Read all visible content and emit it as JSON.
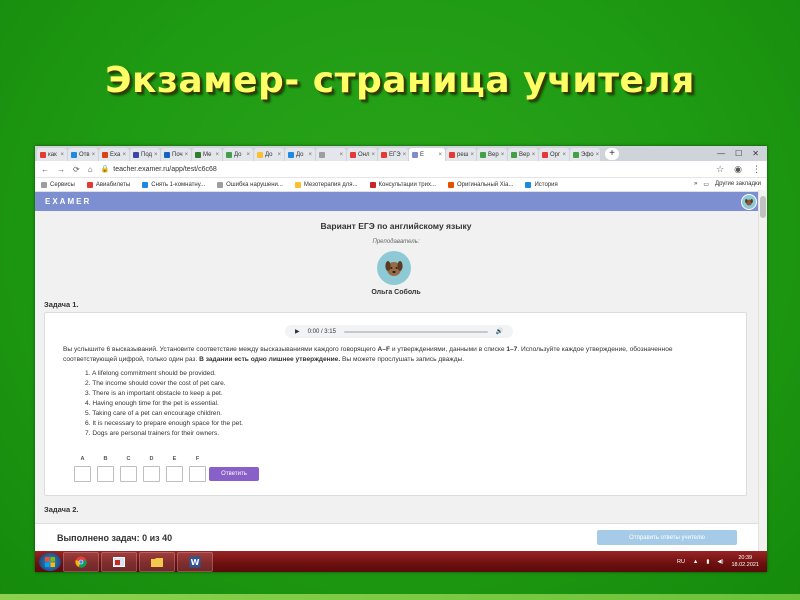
{
  "slide": {
    "title": "Экзамер- страница учителя"
  },
  "colors": {
    "background": "#1f9a13",
    "title": "#ffff66",
    "site_header": "#7d8fd0",
    "answer_button": "#8860c8",
    "send_button": "#a6cbe8",
    "taskbar": "#7a1414"
  },
  "browser": {
    "tabs": [
      {
        "label": "как",
        "color": "#e53935",
        "icon": "yandex-icon"
      },
      {
        "label": "Отв",
        "color": "#1e88e5",
        "icon": "mail-icon"
      },
      {
        "label": "Exa",
        "color": "#d84315",
        "icon": "exam-icon"
      },
      {
        "label": "Под",
        "color": "#3949ab",
        "icon": "flag-icon"
      },
      {
        "label": "Поч",
        "color": "#1565c0",
        "icon": "mail-icon"
      },
      {
        "label": "Ме",
        "color": "#2e7d32",
        "icon": "doc-icon"
      },
      {
        "label": "До",
        "color": "#43a047",
        "icon": "check-icon"
      },
      {
        "label": "До",
        "color": "#fbc02d",
        "icon": "doc-icon"
      },
      {
        "label": "До",
        "color": "#1e88e5",
        "icon": "book-icon"
      },
      {
        "label": "",
        "color": "#9e9e9e",
        "icon": "doc-icon"
      },
      {
        "label": "Онл",
        "color": "#e53935",
        "icon": "doc-icon"
      },
      {
        "label": "ЕГЭ",
        "color": "#e53935",
        "icon": "doc-icon"
      },
      {
        "label": "E",
        "color": "#7d8fd0",
        "icon": "examer-icon",
        "active": true
      },
      {
        "label": "реш",
        "color": "#e53935",
        "icon": "yandex-icon"
      },
      {
        "label": "Вер",
        "color": "#43a047",
        "icon": "check-icon"
      },
      {
        "label": "Вер",
        "color": "#43a047",
        "icon": "check-icon"
      },
      {
        "label": "Орг",
        "color": "#e53935",
        "icon": "yandex-icon"
      },
      {
        "label": "Эфо",
        "color": "#43a047",
        "icon": "check-icon"
      }
    ],
    "new_tab": "+",
    "url": "teacher.examer.ru/app/test/c6c68",
    "bookmarks": [
      {
        "label": "Сервисы",
        "color": "#9e9e9e"
      },
      {
        "label": "Авиабилеты",
        "color": "#e53935"
      },
      {
        "label": "Снять 1-комнатну...",
        "color": "#1e88e5"
      },
      {
        "label": "Ошибка нарушени...",
        "color": "#9e9e9e"
      },
      {
        "label": "Мезотерапия для...",
        "color": "#fbc02d"
      },
      {
        "label": "Консультации трих...",
        "color": "#c62828"
      },
      {
        "label": "Оригинальный Хіа...",
        "color": "#e65100"
      },
      {
        "label": "История",
        "color": "#1e88e5"
      }
    ],
    "other_bookmarks": "Другие закладки"
  },
  "site": {
    "logo": "EXAMER",
    "title": "Вариант ЕГЭ по английскому языку",
    "teacher_label": "Преподаватель:",
    "teacher_name": "Ольга Соболь",
    "task1_label": "Задача 1.",
    "audio_time": "0:00 / 3:15",
    "instructions_before": "Вы услышите 6 высказываний. Установите соответствие между высказываниями каждого говорящего ",
    "instructions_range1": "A–F",
    "instructions_mid": " и утверждениями, данными в списке ",
    "instructions_range2": "1–7",
    "instructions_after": ". Используйте каждое утверждение, обозначенное соответствующей цифрой, только один раз. ",
    "instructions_bold": "В задании есть одно лишнее утверждение.",
    "instructions_end": " Вы можете прослушать запись дважды.",
    "statements": [
      "1. A lifelong commitment should be provided.",
      "2. The income should cover the cost of pet care.",
      "3. There is an important obstacle to keep a pet.",
      "4. Having enough time for the pet is essential.",
      "5. Taking care of a pet can encourage children.",
      "6. It is necessary to prepare enough space for the pet.",
      "7. Dogs are personal trainers for their owners."
    ],
    "letters": [
      "A",
      "B",
      "C",
      "D",
      "E",
      "F"
    ],
    "answer_button": "Ответить",
    "task2_label": "Задача 2.",
    "done_label": "Выполнено задач: 0 из 40",
    "send_button": "Отправить ответы учителю"
  },
  "taskbar": {
    "lang": "RU",
    "time": "20:39",
    "date": "18.02.2021"
  }
}
